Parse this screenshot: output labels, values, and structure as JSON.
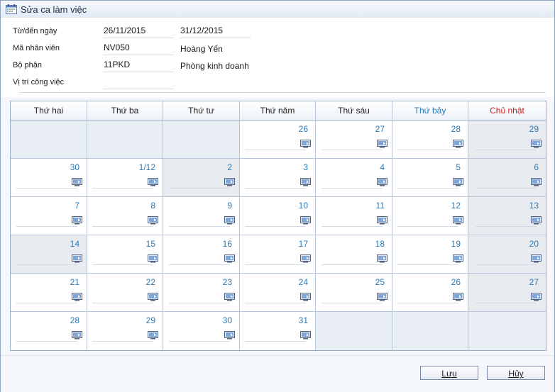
{
  "window": {
    "title": "Sửa ca làm việc"
  },
  "form": {
    "date_range_label": "Từ/đến ngày",
    "from_date": "26/11/2015",
    "to_date": "31/12/2015",
    "employee_id_label": "Mã nhân viên",
    "employee_id": "NV050",
    "employee_name": "Hoàng Yến",
    "department_label": "Bộ phận",
    "department_code": "11PKD",
    "department_name": "Phòng kinh doanh",
    "position_label": "Vị trí công việc",
    "position_value": ""
  },
  "calendar": {
    "headers": [
      "Thứ hai",
      "Thứ ba",
      "Thứ tư",
      "Thứ năm",
      "Thứ sáu",
      "Thứ bảy",
      "Chủ nhật"
    ],
    "colors": {
      "saturday": "#2a7ab8",
      "sunday": "#c8231d",
      "day_number": "#2a7ab8"
    },
    "weeks": [
      [
        {
          "day": "",
          "state": "empty"
        },
        {
          "day": "",
          "state": "empty"
        },
        {
          "day": "",
          "state": "empty"
        },
        {
          "day": "26",
          "state": "normal"
        },
        {
          "day": "27",
          "state": "normal"
        },
        {
          "day": "28",
          "state": "normal"
        },
        {
          "day": "29",
          "state": "gray"
        }
      ],
      [
        {
          "day": "30",
          "state": "normal"
        },
        {
          "day": "1/12",
          "state": "normal"
        },
        {
          "day": "2",
          "state": "gray"
        },
        {
          "day": "3",
          "state": "normal"
        },
        {
          "day": "4",
          "state": "normal"
        },
        {
          "day": "5",
          "state": "normal"
        },
        {
          "day": "6",
          "state": "gray"
        }
      ],
      [
        {
          "day": "7",
          "state": "normal"
        },
        {
          "day": "8",
          "state": "normal"
        },
        {
          "day": "9",
          "state": "normal"
        },
        {
          "day": "10",
          "state": "normal"
        },
        {
          "day": "11",
          "state": "normal"
        },
        {
          "day": "12",
          "state": "normal"
        },
        {
          "day": "13",
          "state": "gray"
        }
      ],
      [
        {
          "day": "14",
          "state": "gray"
        },
        {
          "day": "15",
          "state": "normal"
        },
        {
          "day": "16",
          "state": "normal"
        },
        {
          "day": "17",
          "state": "normal"
        },
        {
          "day": "18",
          "state": "normal"
        },
        {
          "day": "19",
          "state": "normal"
        },
        {
          "day": "20",
          "state": "gray"
        }
      ],
      [
        {
          "day": "21",
          "state": "normal"
        },
        {
          "day": "22",
          "state": "normal"
        },
        {
          "day": "23",
          "state": "normal"
        },
        {
          "day": "24",
          "state": "normal"
        },
        {
          "day": "25",
          "state": "normal"
        },
        {
          "day": "26",
          "state": "normal"
        },
        {
          "day": "27",
          "state": "gray"
        }
      ],
      [
        {
          "day": "28",
          "state": "normal"
        },
        {
          "day": "29",
          "state": "normal"
        },
        {
          "day": "30",
          "state": "normal"
        },
        {
          "day": "31",
          "state": "normal"
        },
        {
          "day": "",
          "state": "empty"
        },
        {
          "day": "",
          "state": "empty"
        },
        {
          "day": "",
          "state": "empty"
        }
      ]
    ],
    "cell_icon": "edit-shift-icon"
  },
  "buttons": {
    "save": "Lưu",
    "cancel": "Hủy"
  }
}
